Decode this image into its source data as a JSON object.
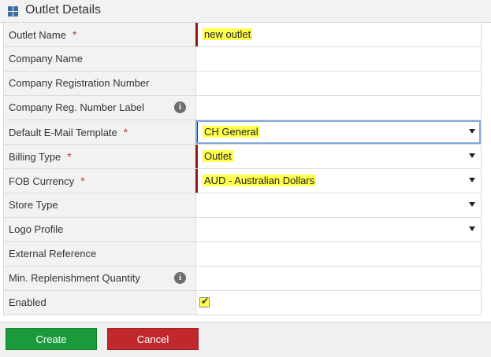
{
  "header": {
    "title": "Outlet Details",
    "icon": "grid-icon"
  },
  "fields": [
    {
      "label": "Outlet Name",
      "required": true,
      "value": "new outlet",
      "kind": "text",
      "highlight": true
    },
    {
      "label": "Company Name",
      "required": false,
      "value": "",
      "kind": "text"
    },
    {
      "label": "Company Registration Number",
      "required": false,
      "value": "",
      "kind": "text"
    },
    {
      "label": "Company Reg. Number Label",
      "required": false,
      "value": "",
      "kind": "text",
      "info": true
    },
    {
      "label": "Default E-Mail Template",
      "required": true,
      "value": "CH General",
      "kind": "select",
      "highlight": true
    },
    {
      "label": "Billing Type",
      "required": true,
      "value": "Outlet",
      "kind": "select",
      "highlight": true
    },
    {
      "label": "FOB Currency",
      "required": true,
      "value": "AUD - Australian Dollars",
      "kind": "select",
      "highlight": true
    },
    {
      "label": "Store Type",
      "required": false,
      "value": "",
      "kind": "select"
    },
    {
      "label": "Logo Profile",
      "required": false,
      "value": "",
      "kind": "select"
    },
    {
      "label": "External Reference",
      "required": false,
      "value": "",
      "kind": "text"
    },
    {
      "label": "Min. Replenishment Quantity",
      "required": false,
      "value": "",
      "kind": "text",
      "info": true
    },
    {
      "label": "Enabled",
      "required": false,
      "value": "",
      "kind": "checkbox",
      "checked": true
    }
  ],
  "required_marker": "*",
  "info_glyph": "i",
  "buttons": {
    "create": "Create",
    "cancel": "Cancel"
  },
  "colors": {
    "create": "#1a9a3a",
    "cancel": "#c0282d",
    "required_bar": "#8b1a1a",
    "highlight": "#ffff4d",
    "header_icon": "#3a6ea8"
  }
}
